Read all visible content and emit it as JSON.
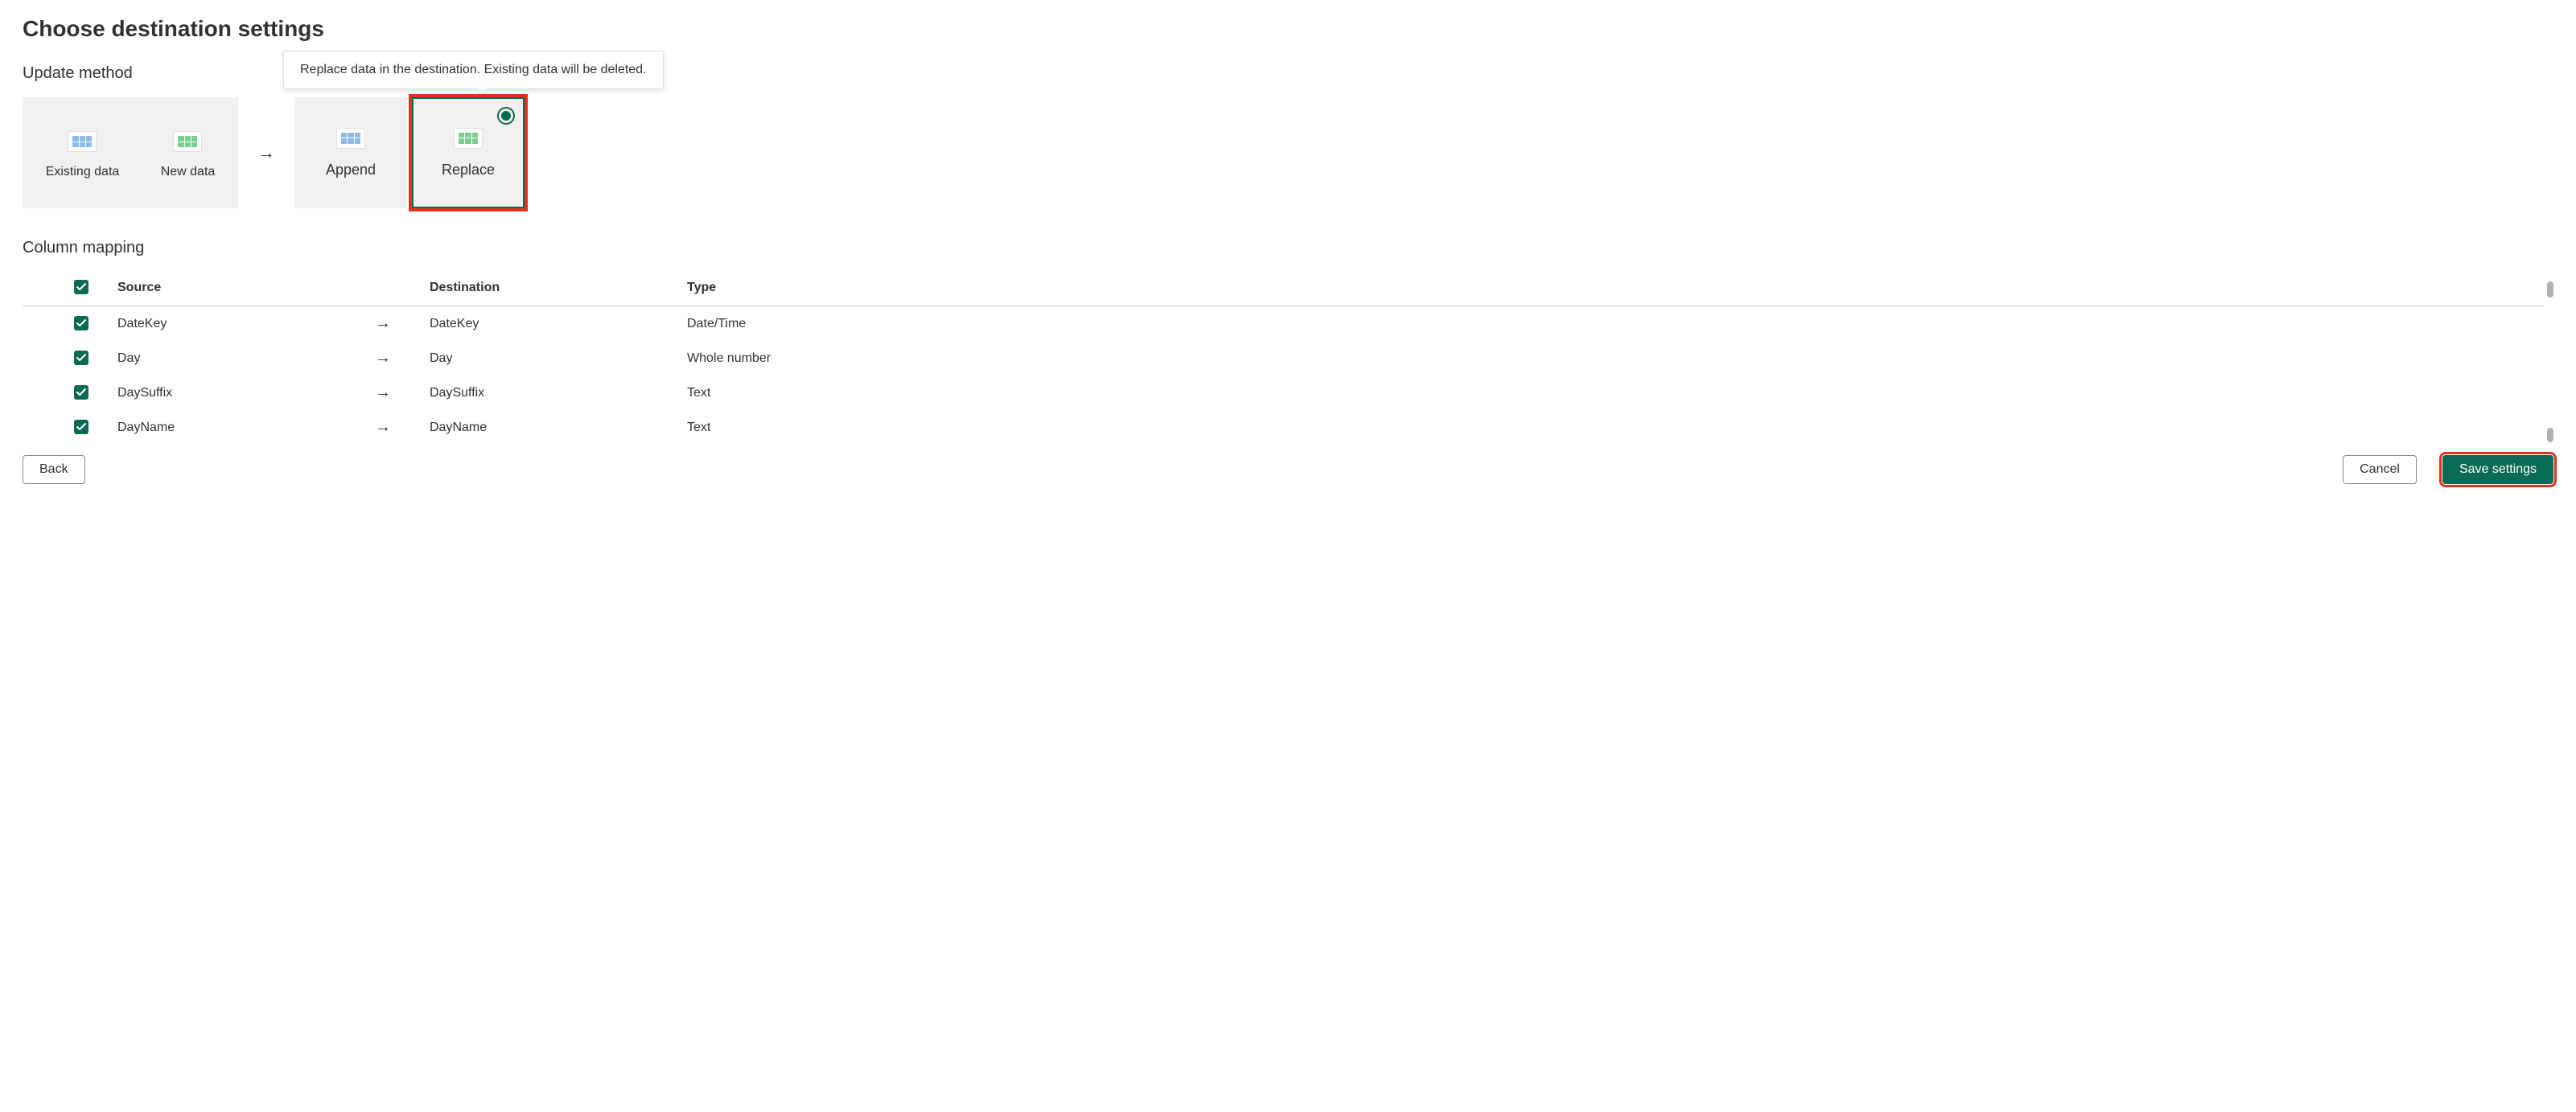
{
  "page_title": "Choose destination settings",
  "update_method": {
    "section_label": "Update method",
    "existing_label": "Existing data",
    "new_label": "New data",
    "append_label": "Append",
    "replace_label": "Replace",
    "tooltip": "Replace data in the destination. Existing data will be deleted."
  },
  "column_mapping": {
    "section_label": "Column mapping",
    "headers": {
      "source": "Source",
      "destination": "Destination",
      "type": "Type"
    },
    "rows": [
      {
        "source": "DateKey",
        "destination": "DateKey",
        "type": "Date/Time"
      },
      {
        "source": "Day",
        "destination": "Day",
        "type": "Whole number"
      },
      {
        "source": "DaySuffix",
        "destination": "DaySuffix",
        "type": "Text"
      },
      {
        "source": "DayName",
        "destination": "DayName",
        "type": "Text"
      }
    ]
  },
  "buttons": {
    "back": "Back",
    "cancel": "Cancel",
    "save": "Save settings"
  }
}
